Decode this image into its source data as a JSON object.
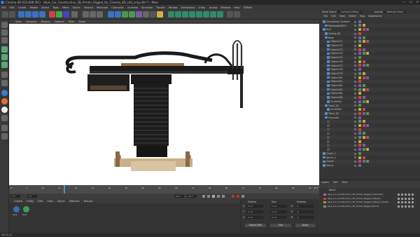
{
  "window": {
    "title": "Cinema 4D R23.008 (RC) - [Apis_Cor_Construction_3D_Printer_Rigged_for_Cinema_4D_c4d_vray.c4d *] - Main",
    "controls": [
      "—",
      "☐",
      "✕"
    ]
  },
  "menubar": [
    "File",
    "Edit",
    "Create",
    "Modes",
    "Select",
    "Tools",
    "Mesh",
    "Spline",
    "Volume",
    "MoGraph",
    "Character",
    "Animate",
    "Simulate",
    "Tracker",
    "Render",
    "Extensions",
    "V-Ray",
    "Arnold",
    "Window",
    "Help",
    "3DRaft"
  ],
  "viewport_menu": [
    "View",
    "Cameras",
    "Display",
    "Options",
    "Filter",
    "Panel"
  ],
  "right_panel": {
    "node_space_label": "Node Space:",
    "node_space_value": "Current (V-Ray)",
    "layout_label": "Layout:",
    "layout_value": "Startup (User)",
    "menu": [
      "File",
      "Edit",
      "View",
      "Object",
      "Tags",
      "Bookmarks"
    ]
  },
  "objects": [
    {
      "name": "Subdivision Surface",
      "indent": 1
    },
    {
      "name": "Rectangle0023",
      "indent": 2
    },
    {
      "name": "Null",
      "indent": 1
    },
    {
      "name": "Casing_All",
      "indent": 2
    },
    {
      "name": "Base",
      "indent": 2
    },
    {
      "name": "Object171",
      "indent": 3
    },
    {
      "name": "Object172",
      "indent": 3
    },
    {
      "name": "Object173",
      "indent": 3
    },
    {
      "name": "Object174",
      "indent": 3
    },
    {
      "name": "Object175",
      "indent": 3
    },
    {
      "name": "Object176",
      "indent": 3
    },
    {
      "name": "Object177",
      "indent": 3
    },
    {
      "name": "Object178",
      "indent": 3
    },
    {
      "name": "Object179",
      "indent": 3
    },
    {
      "name": "Object180",
      "indent": 3
    },
    {
      "name": "Object181",
      "indent": 3
    },
    {
      "name": "Object182",
      "indent": 3
    },
    {
      "name": "Object183",
      "indent": 3
    },
    {
      "name": "Object184",
      "indent": 3
    },
    {
      "name": "Object185",
      "indent": 3
    },
    {
      "name": "Circle002",
      "indent": 3
    },
    {
      "name": "Track_01",
      "indent": 2
    },
    {
      "name": "Circle001",
      "indent": 3
    },
    {
      "name": "Track_02",
      "indent": 2
    },
    {
      "name": "Supports",
      "indent": 2
    },
    {
      "name": "",
      "indent": 3
    },
    {
      "name": "",
      "indent": 3
    },
    {
      "name": "",
      "indent": 3
    },
    {
      "name": "",
      "indent": 3
    },
    {
      "name": "",
      "indent": 3
    },
    {
      "name": "",
      "indent": 3
    },
    {
      "name": "",
      "indent": 3
    },
    {
      "name": "",
      "indent": 3
    },
    {
      "name": "Cover_1",
      "indent": 1
    },
    {
      "name": "Spline_1",
      "indent": 1
    },
    {
      "name": "Cloner",
      "indent": 1
    },
    {
      "name": "Spline",
      "indent": 1
    }
  ],
  "layers": {
    "tabs": [
      "Layers",
      "Edit",
      "View"
    ],
    "header": "Name",
    "items": [
      {
        "name": "Apis_Cor_Construction_3D_Printer_Rigged_Geometry",
        "color": "#b05cc0"
      },
      {
        "name": "Apis_Cor_Construction_3D_Printer_Rigged_Helpers",
        "color": "#c04040"
      },
      {
        "name": "Apis_Cor_Construction_3D_Printer_Rigged_Helpers_Freeze",
        "color": "#d08040"
      },
      {
        "name": "Apis_Cor_Construction_3D_Printer_Rigged_Bones",
        "color": "#60a060"
      }
    ]
  },
  "timeline": {
    "ticks": [
      "0",
      "5",
      "10",
      "15",
      "20",
      "25",
      "30",
      "35",
      "40",
      "45",
      "50",
      "55",
      "60",
      "65",
      "70",
      "75",
      "80",
      "85",
      "90"
    ],
    "end_label": "90 F"
  },
  "playbar": {
    "start": "0 F",
    "current": "0 F",
    "end": "90 F",
    "end2": "90 F"
  },
  "material": {
    "menu": [
      "Create",
      "V-Ray",
      "Edit",
      "View",
      "Select",
      "Material",
      "Texture"
    ],
    "swatches": [
      "Apis",
      "Apis"
    ]
  },
  "attributes": {
    "headers": [
      "Position",
      "Size",
      "Rotation"
    ],
    "rows": [
      {
        "label": "X",
        "pos": "0 cm",
        "size": "0 cm",
        "rlabel": "H",
        "rot": "0°"
      },
      {
        "label": "Y",
        "pos": "0 cm",
        "size": "0 cm",
        "rlabel": "P",
        "rot": "0°"
      },
      {
        "label": "Z",
        "pos": "0 cm",
        "size": "0 cm",
        "rlabel": "B",
        "rot": "0°"
      }
    ],
    "mode1": "Object (Rel)",
    "mode2": "Size",
    "apply": "Apply"
  },
  "status": "00:00:14"
}
